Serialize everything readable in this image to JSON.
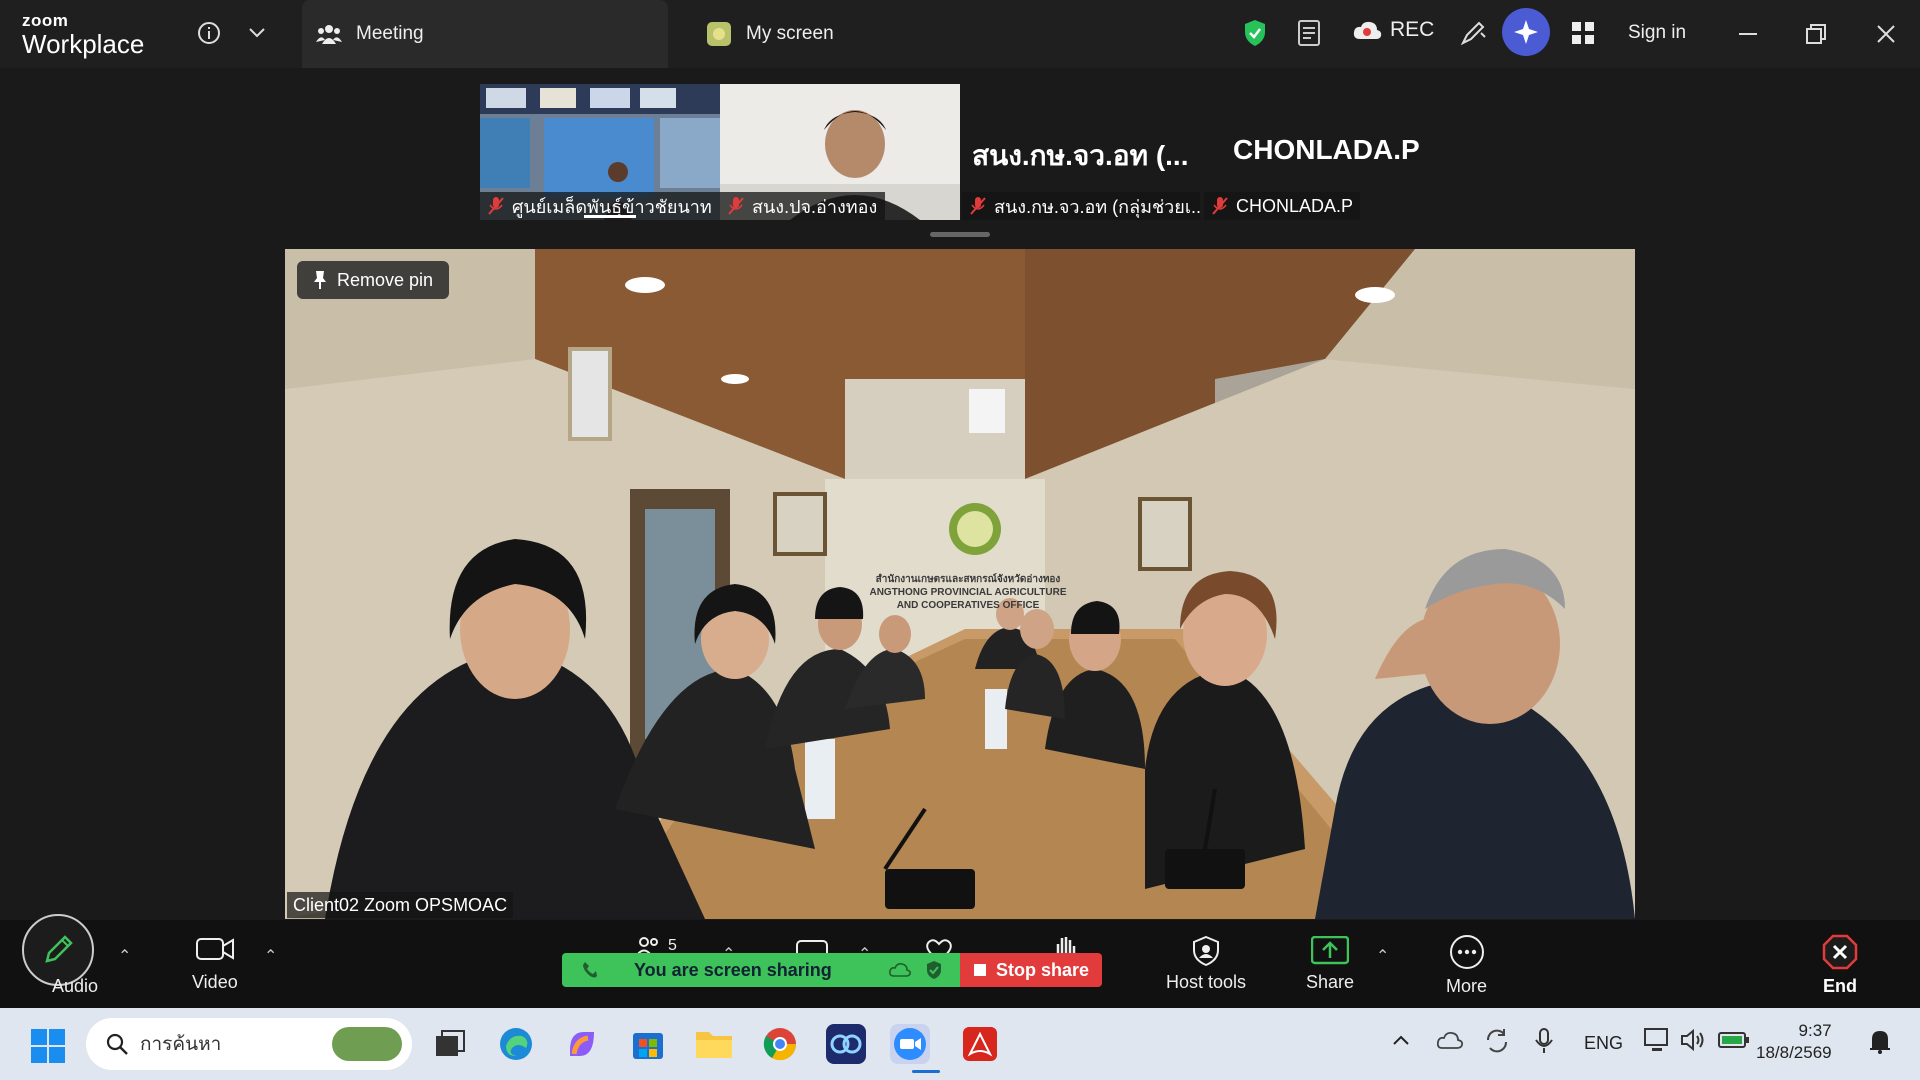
{
  "app": {
    "logo_small": "zoom",
    "logo_big": "Workplace"
  },
  "tabs": {
    "meeting": "Meeting",
    "my_screen": "My screen"
  },
  "header": {
    "rec_label": "REC",
    "sign_in": "Sign in"
  },
  "participants": [
    {
      "label": "ศูนย์เมล็ดพันธุ์ข้าวชัยนาท"
    },
    {
      "label": "สนง.ปจ.อ่างทอง"
    },
    {
      "label": "สนง.กษ.จว.อท (กลุ่มช่วยเ...",
      "big_name": "สนง.กษ.จว.อท (..."
    },
    {
      "label": "CHONLADA.P",
      "big_name": "CHONLADA.P"
    }
  ],
  "main_video": {
    "pin_label": "Remove pin",
    "speaker_name": "Client02 Zoom OPSMOAC",
    "sign_th": "สำนักงานเกษตรและสหกรณ์จังหวัดอ่างทอง",
    "sign_en1": "ANGTHONG PROVINCIAL AGRICULTURE",
    "sign_en2": "AND COOPERATIVES OFFICE"
  },
  "toolbar": {
    "audio": "Audio",
    "video": "Video",
    "participants_count": "5",
    "host_tools": "Host tools",
    "share": "Share",
    "more": "More",
    "end": "End",
    "sharing_status": "You are screen sharing",
    "stop_share": "Stop share"
  },
  "taskbar": {
    "search_placeholder": "การค้นหา",
    "lang": "ENG",
    "time": "9:37",
    "date": "18/8/2569"
  },
  "colors": {
    "accent_green": "#3ec25a",
    "stop_red": "#e23b3b",
    "end_red": "#e23b3b",
    "background": "#1a1a1a"
  }
}
